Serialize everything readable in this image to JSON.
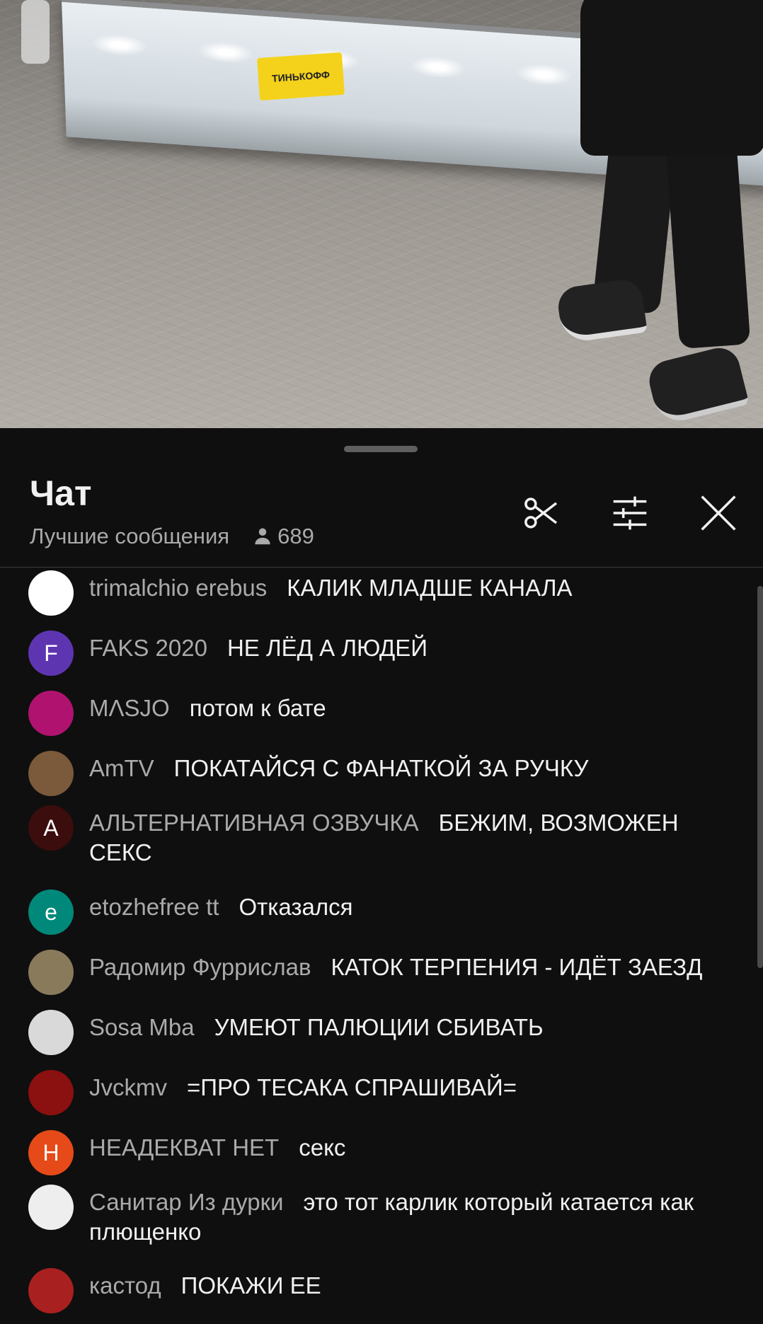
{
  "video": {
    "sponsor_label": "ТИНЬКОФФ"
  },
  "chat": {
    "title": "Чат",
    "mode_label": "Лучшие сообщения",
    "viewer_count": "689",
    "icons": {
      "clip": "scissors-icon",
      "filter": "sliders-icon",
      "close": "close-icon",
      "viewers": "person-icon"
    },
    "messages": [
      {
        "author": "trimalchio erebus",
        "text": "КАЛИК МЛАДШЕ КАНАЛА",
        "avatar_letter": "",
        "avatar_color": "#ffffff"
      },
      {
        "author": "FAKS 2020",
        "text": "НЕ ЛЁД А ЛЮДЕЙ",
        "avatar_letter": "F",
        "avatar_color": "#5e35b1"
      },
      {
        "author": "MɅSJO",
        "text": "потом к бате",
        "avatar_letter": "",
        "avatar_color": "#b0136f"
      },
      {
        "author": "AmTV",
        "text": "ПОКАТАЙСЯ С ФАНАТКОЙ ЗА РУЧКУ",
        "avatar_letter": "",
        "avatar_color": "#7a5a3a"
      },
      {
        "author": "АЛЬТЕРНАТИВНАЯ ОЗВУЧКА",
        "text": "БЕЖИМ, ВОЗМОЖЕН СЕКС",
        "avatar_letter": "A",
        "avatar_color": "#3b0d0d"
      },
      {
        "author": "etozhefree tt",
        "text": "Отказался",
        "avatar_letter": "e",
        "avatar_color": "#00897b"
      },
      {
        "author": "Радомир Фуррислав",
        "text": "КАТОК ТЕРПЕНИЯ - ИДЁТ ЗАЕЗД",
        "avatar_letter": "",
        "avatar_color": "#8a7a5c"
      },
      {
        "author": "Sosa Mba",
        "text": "УМЕЮТ ПАЛЮЦИИ СБИВАТЬ",
        "avatar_letter": "",
        "avatar_color": "#d9d9d9"
      },
      {
        "author": "Jvckmv",
        "text": "=ПРО ТЕСАКА СПРАШИВАЙ=",
        "avatar_letter": "",
        "avatar_color": "#8b1010"
      },
      {
        "author": "НЕАДЕКВАТ НЕТ",
        "text": "секс",
        "avatar_letter": "H",
        "avatar_color": "#e64a19"
      },
      {
        "author": "Санитар Из дурки",
        "text": "это тот карлик который катается как плющенко",
        "avatar_letter": "",
        "avatar_color": "#eeeeee"
      },
      {
        "author": "кастод",
        "text": "ПОКАЖИ ЕЕ",
        "avatar_letter": "",
        "avatar_color": "#a82020"
      }
    ]
  }
}
